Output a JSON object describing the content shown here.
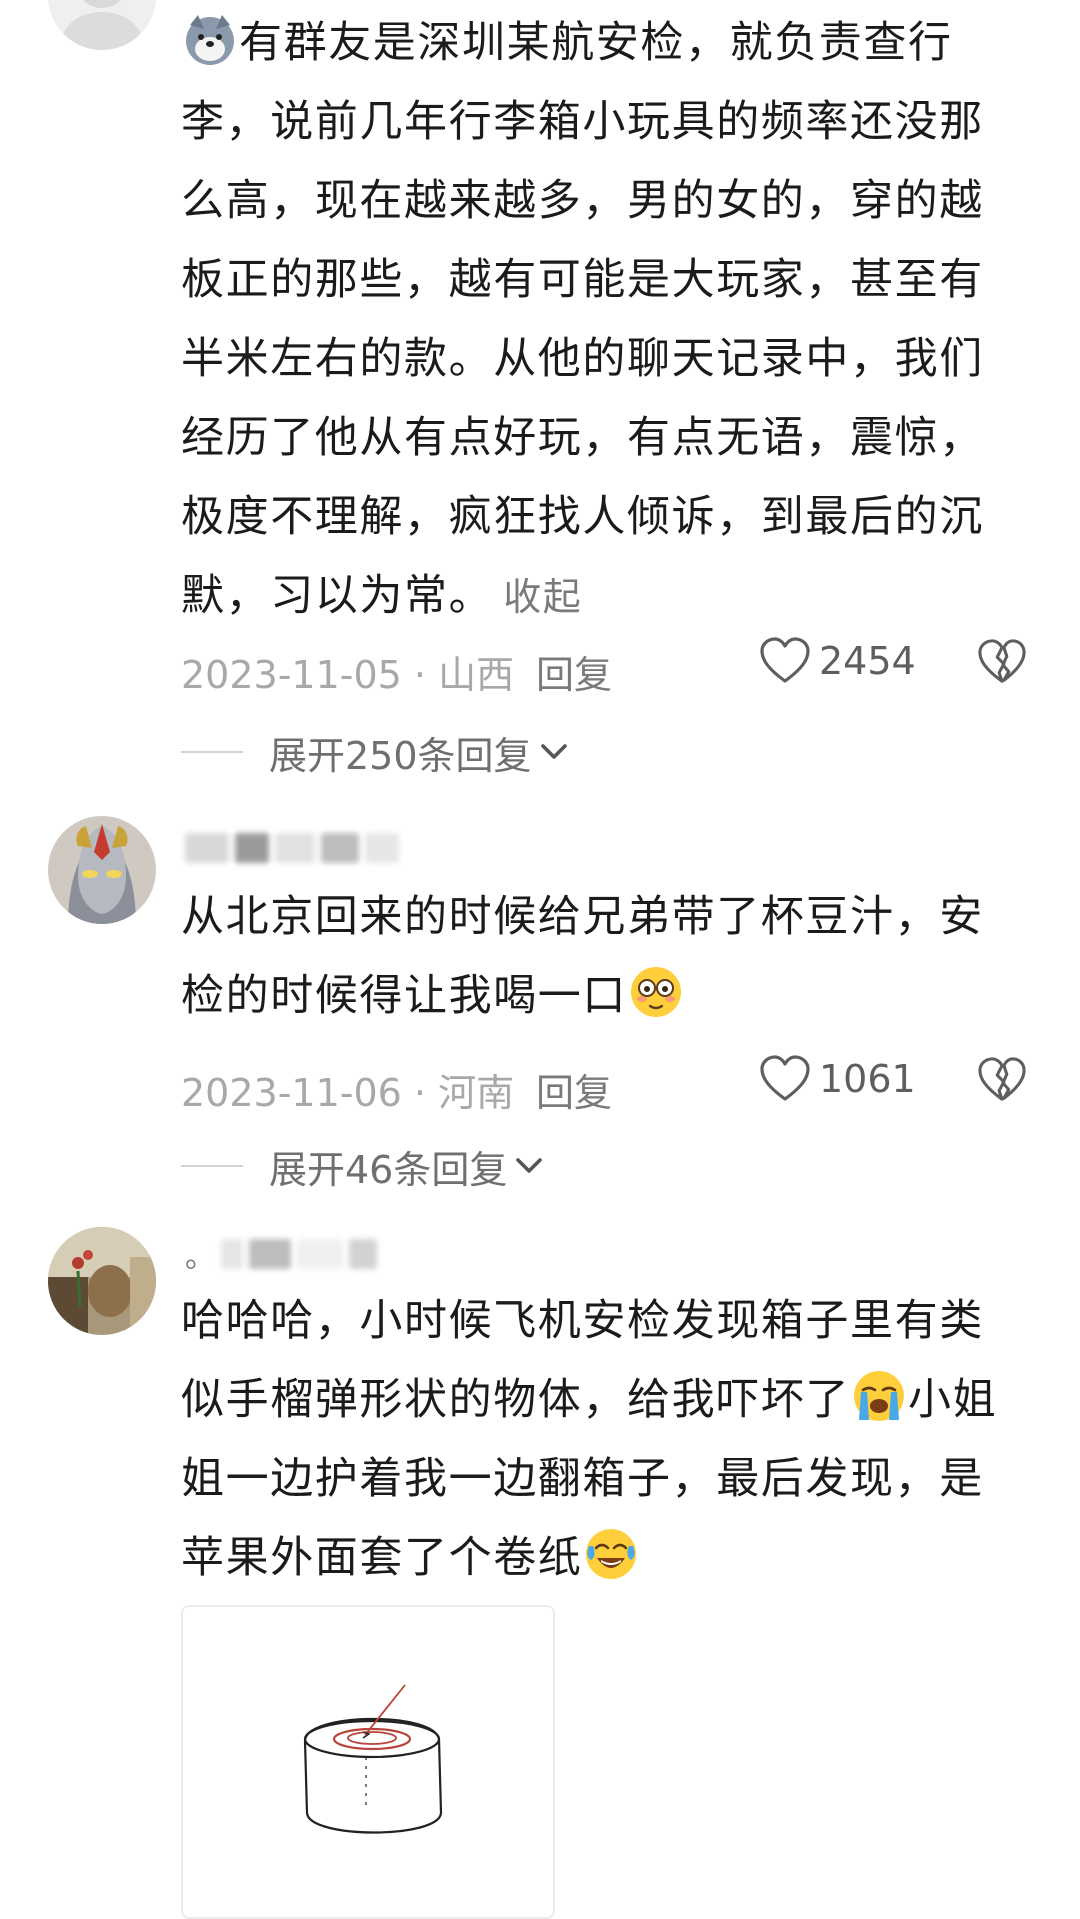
{
  "comments": [
    {
      "text_before_emoji": "",
      "text": "有群友是深圳某航安检，就负责查行李，说前几年行李箱小玩具的频率还没那么高，现在越来越多，男的女的，穿的越板正的那些，越有可能是大玩家，甚至有半米左右的款。从他的聊天记录中，我们经历了他从有点好玩，有点无语，震惊，极度不理解，疯狂找人倾诉，到最后的沉默，习以为常。",
      "collapse_label": "收起",
      "leading_emoji": "dog-face-emoji",
      "date_location": "2023-11-05 · 山西",
      "reply_label": "回复",
      "likes": "2454",
      "expand_label": "展开250条回复"
    },
    {
      "text": "从北京回来的时候给兄弟带了杯豆汁，安检的时候得让我喝一口",
      "trailing_emoji": "flushed-face-emoji",
      "date_location": "2023-11-06 · 河南",
      "reply_label": "回复",
      "likes": "1061",
      "expand_label": "展开46条回复"
    },
    {
      "username_prefix": "。",
      "text_part1": "哈哈哈，小时候飞机安检发现箱子里有类似手榴弹形状的物体，给我吓坏了",
      "emoji1": "loudly-crying-face-emoji",
      "text_part2": "小姐姐一边护着我一边翻箱子，最后发现，是苹果外面套了个卷纸",
      "emoji2": "tears-of-joy-emoji"
    }
  ],
  "colors": {
    "text": "#1b1b1b",
    "meta": "#a8a8a8",
    "link": "#7a7a7a",
    "divider": "#d4d4d4"
  }
}
